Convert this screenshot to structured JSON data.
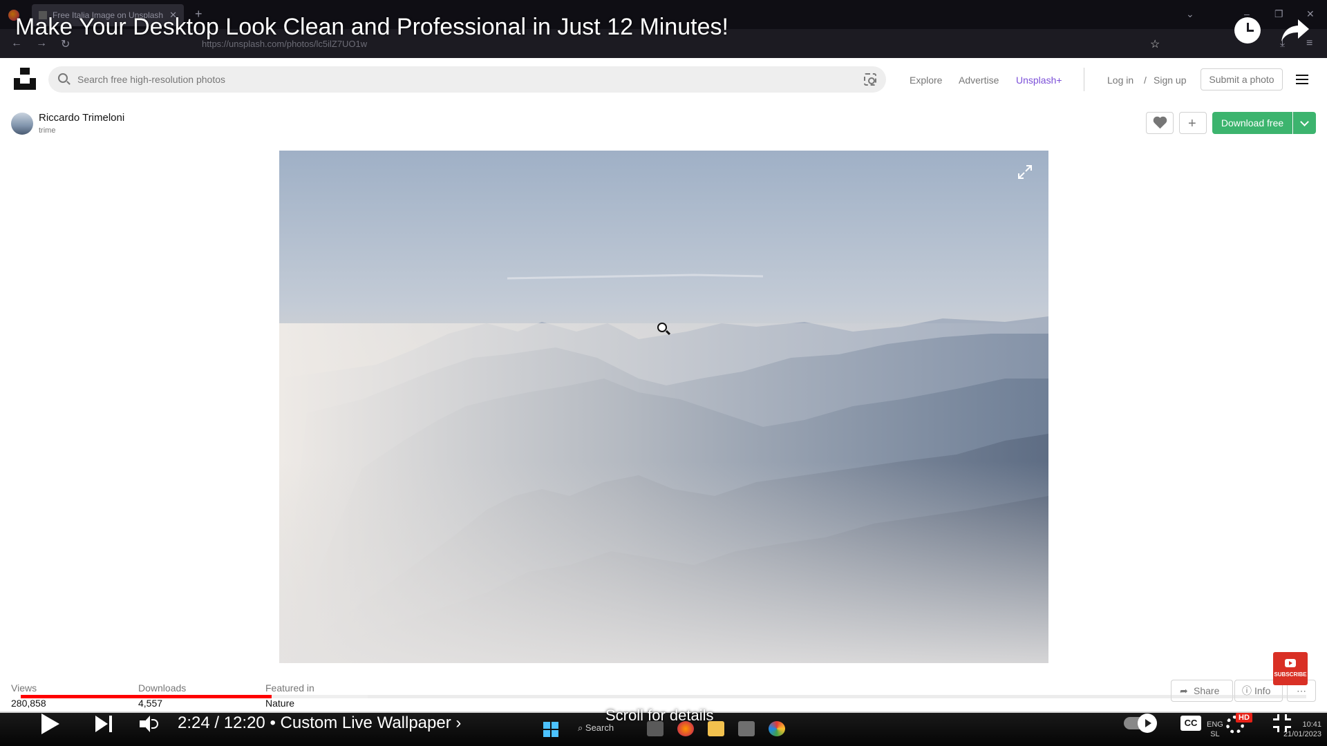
{
  "browser": {
    "tab_title": "Free Italia Image on Unsplash",
    "url": "https://unsplash.com/photos/lc5ilZ7UO1w"
  },
  "youtube": {
    "video_title": "Make Your Desktop Look Clean and Professional in Just 12 Minutes!",
    "time": "2:24 / 12:20 • Custom Live Wallpaper ›",
    "progress_fraction": 0.195,
    "buffered_fraction": 0.27,
    "scroll_hint": "Scroll for details",
    "subscribe_label": "SUBSCRIBE",
    "hd_label": "HD",
    "cc_label": "CC"
  },
  "unsplash": {
    "search_placeholder": "Search free high-resolution photos",
    "nav": {
      "explore": "Explore",
      "advertise": "Advertise",
      "plus": "Unsplash+",
      "login": "Log in",
      "slash": "/",
      "signup": "Sign up",
      "submit": "Submit a photo"
    },
    "author": {
      "name": "Riccardo Trimeloni",
      "handle": "trime"
    },
    "download_label": "Download free",
    "stats": {
      "views_label": "Views",
      "views_value": "280,858",
      "downloads_label": "Downloads",
      "downloads_value": "4,557",
      "featured_label": "Featured in",
      "featured_value": "Nature"
    },
    "share_label": "Share",
    "info_label": "Info"
  },
  "taskbar": {
    "search_label": "Search",
    "lang_top": "ENG",
    "lang_bottom": "SL",
    "time": "10:41",
    "date": "21/01/2023"
  },
  "colors": {
    "accent_green": "#3cb46e",
    "youtube_red": "#ff0000",
    "unsplash_plus": "#7b4fd8"
  }
}
